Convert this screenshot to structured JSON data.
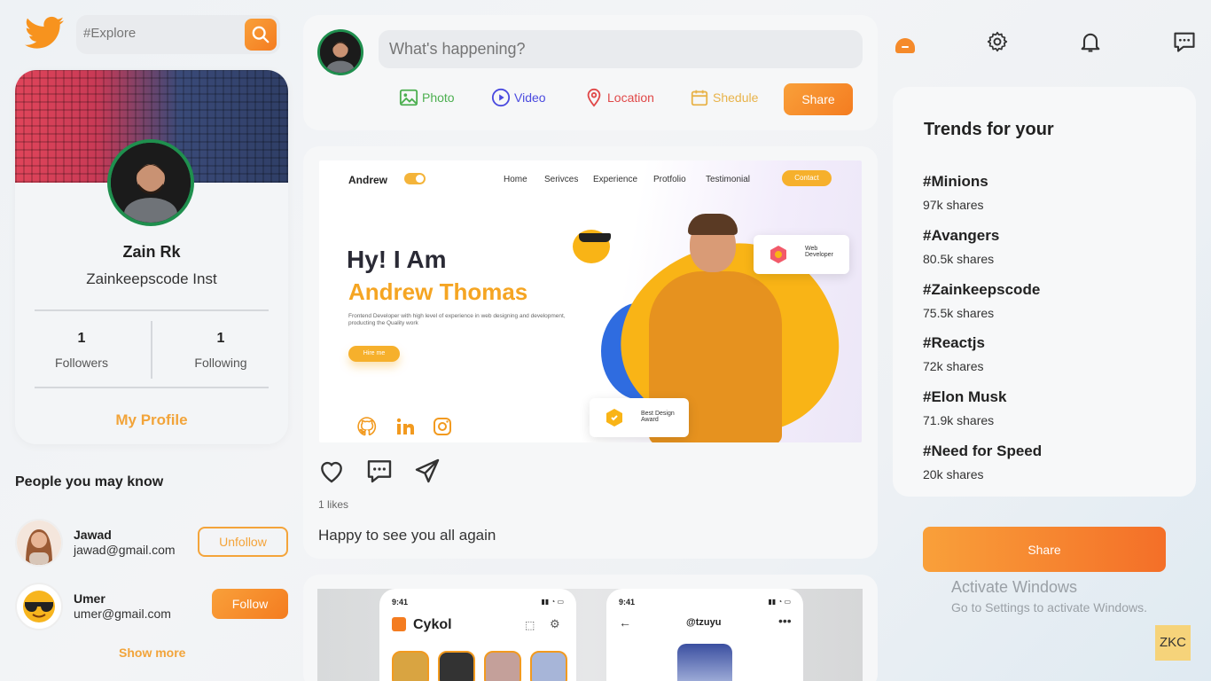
{
  "search": {
    "placeholder": "#Explore"
  },
  "profile": {
    "name": "Zain Rk",
    "handle": "Zainkeepscode Inst",
    "followers_count": "1",
    "followers_label": "Followers",
    "following_count": "1",
    "following_label": "Following",
    "my_profile_label": "My Profile"
  },
  "people": {
    "title": "People you may know",
    "items": [
      {
        "name": "Jawad",
        "email": "jawad@gmail.com",
        "action": "Unfollow"
      },
      {
        "name": "Umer",
        "email": "umer@gmail.com",
        "action": "Follow"
      }
    ],
    "show_more": "Show more"
  },
  "composer": {
    "placeholder": "What's happening?",
    "options": [
      {
        "label": "Photo",
        "icon": "photo-icon",
        "color": "#4caf50"
      },
      {
        "label": "Video",
        "icon": "video-icon",
        "color": "#4a4adf"
      },
      {
        "label": "Location",
        "icon": "location-icon",
        "color": "#e04848"
      },
      {
        "label": "Shedule",
        "icon": "calendar-icon",
        "color": "#e8b34a"
      }
    ],
    "share_label": "Share"
  },
  "post": {
    "preview": {
      "brand": "Andrew",
      "nav": [
        "Home",
        "Serivces",
        "Experience",
        "Protfolio",
        "Testimonial"
      ],
      "contact": "Contact",
      "greeting": "Hy! I Am",
      "name": "Andrew Thomas",
      "description": "Frontend Developer with high level of experience in web designing and development, producting the Quality work",
      "hire": "Hire me",
      "badge_top": "Web Developer",
      "badge_bottom": "Best Design Award"
    },
    "likes": "1 likes",
    "caption": "Happy to see you all again"
  },
  "post2": {
    "time_left": "9:41",
    "app_name": "Cykol",
    "time_right": "9:41",
    "user_handle": "@tzuyu"
  },
  "trends": {
    "title": "Trends for your",
    "items": [
      {
        "tag": "#Minions",
        "shares": "97k shares"
      },
      {
        "tag": "#Avangers",
        "shares": "80.5k shares"
      },
      {
        "tag": "#Zainkeepscode",
        "shares": "75.5k shares"
      },
      {
        "tag": "#Reactjs",
        "shares": "72k shares"
      },
      {
        "tag": "#Elon Musk",
        "shares": "71.9k shares"
      },
      {
        "tag": "#Need for Speed",
        "shares": "20k shares"
      }
    ]
  },
  "right_share_label": "Share",
  "watermark": {
    "line1": "Activate Windows",
    "line2": "Go to Settings to activate Windows.",
    "corner": "ZKC"
  },
  "colors": {
    "accent": "#f47c20",
    "accent_light": "#f9a03a",
    "online_ring": "#1f8f4e"
  }
}
